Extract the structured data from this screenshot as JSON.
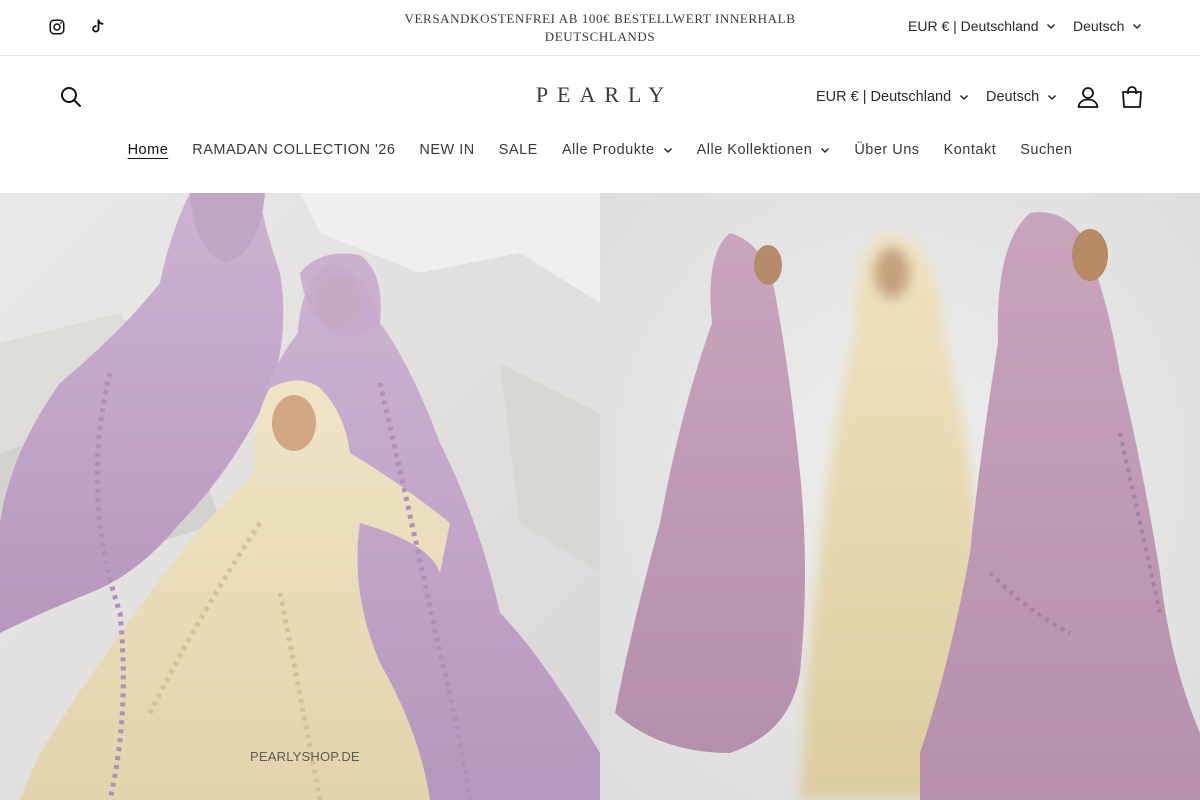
{
  "announcement": {
    "text_line1": "VERSANDKOSTENFREI AB 100€ BESTELLWERT INNERHALB",
    "text_line2": "DEUTSCHLANDS",
    "currency": "EUR € | Deutschland",
    "language": "Deutsch"
  },
  "social": {
    "icons": [
      "instagram-icon",
      "tiktok-icon"
    ]
  },
  "header": {
    "logo": "PEARLY",
    "currency": "EUR € | Deutschland",
    "language": "Deutsch"
  },
  "nav": {
    "items": [
      {
        "label": "Home",
        "active": true
      },
      {
        "label": "RAMADAN COLLECTION '26"
      },
      {
        "label": "NEW IN"
      },
      {
        "label": "SALE"
      },
      {
        "label": "Alle Produkte",
        "dropdown": true
      },
      {
        "label": "Alle Kollektionen",
        "dropdown": true
      },
      {
        "label": "Über Uns"
      },
      {
        "label": "Kontakt"
      },
      {
        "label": "Suchen"
      }
    ]
  },
  "hero": {
    "watermark": "PEARLYSHOP.DE"
  },
  "colors": {
    "lilac": "#c7a9c9",
    "cream": "#ece1c4",
    "wall": "#e8e8e8"
  }
}
